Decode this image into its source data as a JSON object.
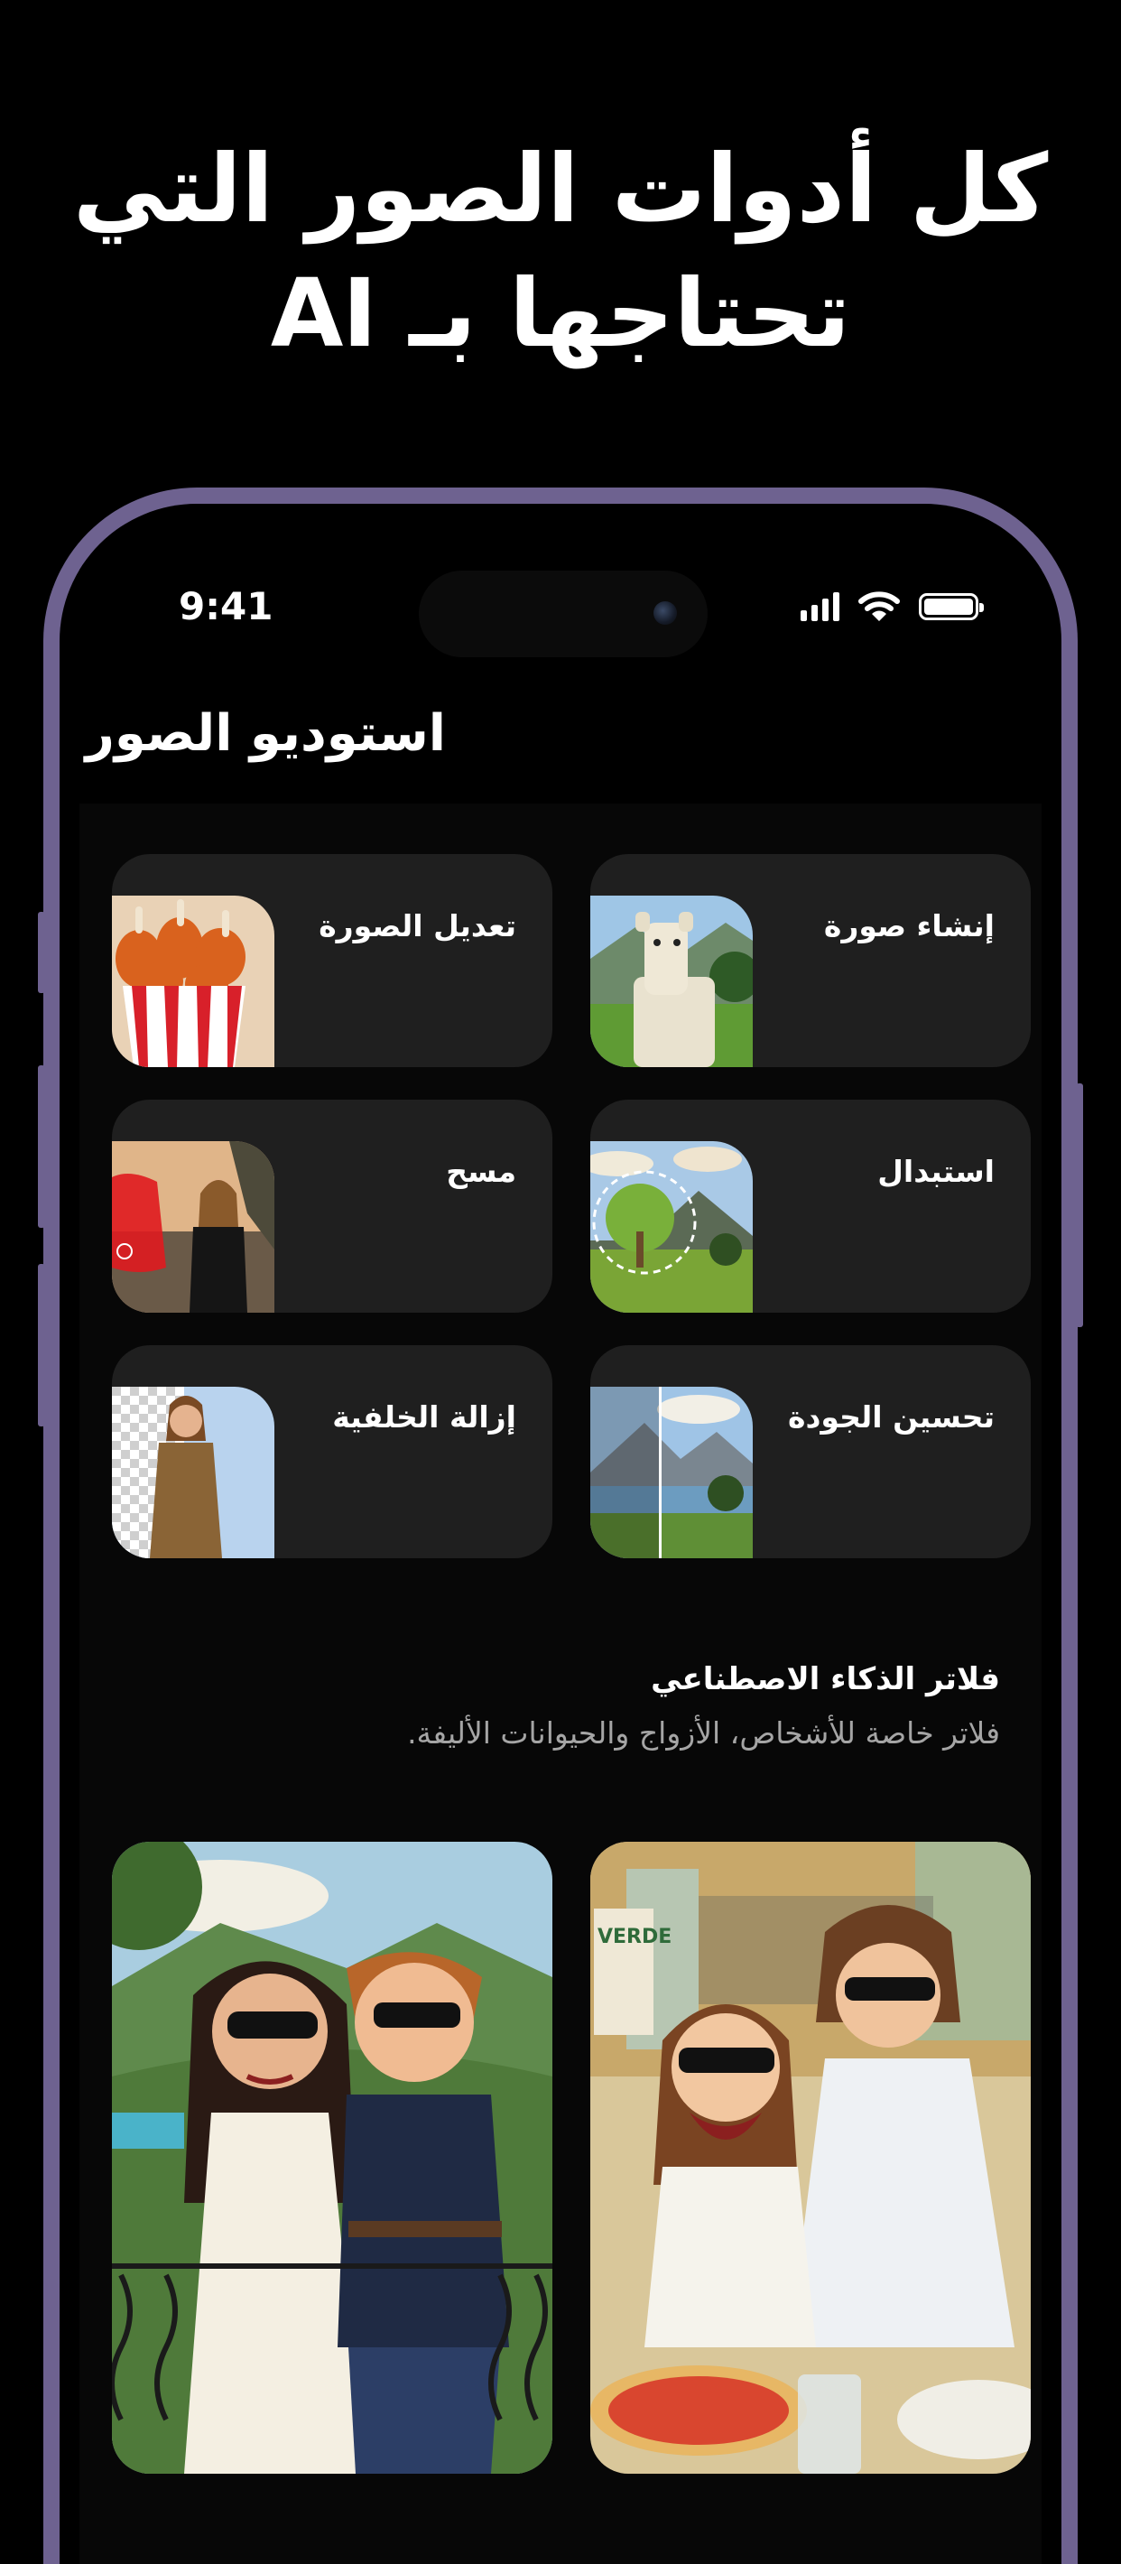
{
  "headline": {
    "line1": "كل أدوات الصور التي",
    "line2": "تحتاجها بـ AI"
  },
  "status_bar": {
    "time": "9:41",
    "signal_bars": 4,
    "battery_fraction": 1.0
  },
  "app": {
    "title": "استوديو الصور"
  },
  "tools": [
    {
      "label": "إنشاء صورة",
      "icon": "alpaca-image"
    },
    {
      "label": "تعديل الصورة",
      "icon": "fried-chicken-bucket-image"
    },
    {
      "label": "استبدال",
      "icon": "tree-landscape-image"
    },
    {
      "label": "مسح",
      "icon": "woman-beach-erase-image"
    },
    {
      "label": "تحسين الجودة",
      "icon": "mountain-lake-before-after-image"
    },
    {
      "label": "إزالة الخلفية",
      "icon": "woman-transparent-background-image"
    }
  ],
  "filters": {
    "title": "فلاتر الذكاء الاصطناعي",
    "subtitle": "فلاتر خاصة للأشخاص، الأزواج والحيوانات الأليفة.",
    "cards": [
      {
        "image": "cartoon-couple-cafe-illustration",
        "sign_text": "VERDE"
      },
      {
        "image": "cartoon-couple-balcony-illustration"
      }
    ]
  },
  "colors": {
    "background": "#000000",
    "frame": "#6e6290",
    "card": "#1f1f1f",
    "subtitle": "#a5a5a5"
  }
}
